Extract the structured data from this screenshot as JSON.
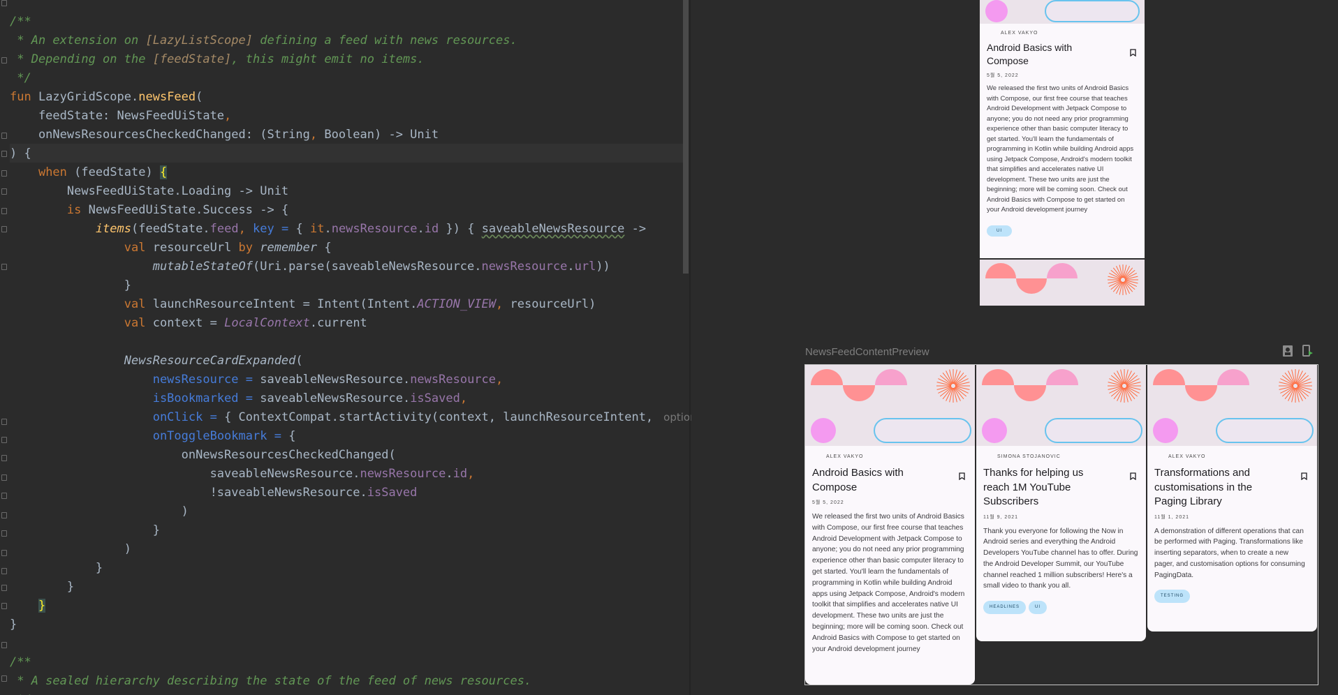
{
  "editor": {
    "lines": [
      {
        "segs": [
          {
            "t": "/**",
            "c": "cm"
          }
        ]
      },
      {
        "segs": [
          {
            "t": " * An extension on ",
            "c": "cm"
          },
          {
            "t": "[LazyListScope]",
            "c": "cmref"
          },
          {
            "t": " defining a feed with news resources.",
            "c": "cm"
          }
        ]
      },
      {
        "segs": [
          {
            "t": " * Depending on the ",
            "c": "cm"
          },
          {
            "t": "[feedState]",
            "c": "cmref"
          },
          {
            "t": ", this might emit no items.",
            "c": "cm"
          }
        ]
      },
      {
        "segs": [
          {
            "t": " */",
            "c": "cm"
          }
        ]
      },
      {
        "segs": [
          {
            "t": "fun ",
            "c": "kw"
          },
          {
            "t": "LazyGridScope.",
            "c": ""
          },
          {
            "t": "newsFeed",
            "c": "fn"
          },
          {
            "t": "(",
            "c": ""
          }
        ]
      },
      {
        "segs": [
          {
            "t": "    feedState: NewsFeedUiState",
            "c": ""
          },
          {
            "t": ",",
            "c": "kw"
          }
        ]
      },
      {
        "segs": [
          {
            "t": "    onNewsResourcesCheckedChanged: (String",
            "c": ""
          },
          {
            "t": ", ",
            "c": "kw"
          },
          {
            "t": "Boolean) -> Unit",
            "c": ""
          }
        ]
      },
      {
        "segs": [
          {
            "t": ") {",
            "c": ""
          }
        ]
      },
      {
        "segs": [
          {
            "t": "    ",
            "c": ""
          },
          {
            "t": "when ",
            "c": "kw"
          },
          {
            "t": "(feedState) ",
            "c": ""
          },
          {
            "t": "{",
            "c": "brace-hl"
          }
        ]
      },
      {
        "segs": [
          {
            "t": "        NewsFeedUiState.Loading -> Unit",
            "c": ""
          }
        ]
      },
      {
        "segs": [
          {
            "t": "        ",
            "c": ""
          },
          {
            "t": "is ",
            "c": "kw"
          },
          {
            "t": "NewsFeedUiState.Success -> {",
            "c": ""
          }
        ]
      },
      {
        "segs": [
          {
            "t": "            ",
            "c": ""
          },
          {
            "t": "items",
            "c": "fn ital"
          },
          {
            "t": "(feedState.",
            "c": ""
          },
          {
            "t": "feed",
            "c": "prop"
          },
          {
            "t": ", ",
            "c": "kw"
          },
          {
            "t": "key ",
            "c": "named"
          },
          {
            "t": "= ",
            "c": "named"
          },
          {
            "t": "{ ",
            "c": ""
          },
          {
            "t": "it",
            "c": "kw"
          },
          {
            "t": ".",
            "c": ""
          },
          {
            "t": "newsResource",
            "c": "prop"
          },
          {
            "t": ".",
            "c": ""
          },
          {
            "t": "id",
            "c": "prop"
          },
          {
            "t": " }) { ",
            "c": ""
          },
          {
            "t": "saveableNewsResource",
            "c": "wavy"
          },
          {
            "t": " ->",
            "c": ""
          }
        ]
      },
      {
        "segs": [
          {
            "t": "                ",
            "c": ""
          },
          {
            "t": "val ",
            "c": "kw"
          },
          {
            "t": "resourceUrl ",
            "c": ""
          },
          {
            "t": "by ",
            "c": "kw"
          },
          {
            "t": "remember",
            "c": "ital"
          },
          {
            "t": " {",
            "c": ""
          }
        ]
      },
      {
        "segs": [
          {
            "t": "                    ",
            "c": ""
          },
          {
            "t": "mutableStateOf",
            "c": "ital"
          },
          {
            "t": "(Uri.parse(saveableNewsResource.",
            "c": ""
          },
          {
            "t": "newsResource",
            "c": "prop"
          },
          {
            "t": ".",
            "c": ""
          },
          {
            "t": "url",
            "c": "prop"
          },
          {
            "t": "))",
            "c": ""
          }
        ]
      },
      {
        "segs": [
          {
            "t": "                }",
            "c": ""
          }
        ]
      },
      {
        "segs": [
          {
            "t": "                ",
            "c": ""
          },
          {
            "t": "val ",
            "c": "kw"
          },
          {
            "t": "launchResourceIntent = Intent(Intent.",
            "c": ""
          },
          {
            "t": "ACTION_VIEW",
            "c": "prop ital"
          },
          {
            "t": ", ",
            "c": "kw"
          },
          {
            "t": "resourceUrl)",
            "c": ""
          }
        ]
      },
      {
        "segs": [
          {
            "t": "                ",
            "c": ""
          },
          {
            "t": "val ",
            "c": "kw"
          },
          {
            "t": "context = ",
            "c": ""
          },
          {
            "t": "LocalContext",
            "c": "prop ital"
          },
          {
            "t": ".current",
            "c": ""
          }
        ]
      },
      {
        "segs": [
          {
            "t": "",
            "c": ""
          }
        ]
      },
      {
        "segs": [
          {
            "t": "                ",
            "c": ""
          },
          {
            "t": "NewsResourceCardExpanded",
            "c": "ital"
          },
          {
            "t": "(",
            "c": ""
          }
        ]
      },
      {
        "segs": [
          {
            "t": "                    ",
            "c": ""
          },
          {
            "t": "newsResource ",
            "c": "named"
          },
          {
            "t": "= ",
            "c": "named"
          },
          {
            "t": "saveableNewsResource.",
            "c": ""
          },
          {
            "t": "newsResource",
            "c": "prop"
          },
          {
            "t": ",",
            "c": "kw"
          }
        ]
      },
      {
        "segs": [
          {
            "t": "                    ",
            "c": ""
          },
          {
            "t": "isBookmarked ",
            "c": "named"
          },
          {
            "t": "= ",
            "c": "named"
          },
          {
            "t": "saveableNewsResource.",
            "c": ""
          },
          {
            "t": "isSaved",
            "c": "prop"
          },
          {
            "t": ",",
            "c": "kw"
          }
        ]
      },
      {
        "segs": [
          {
            "t": "                    ",
            "c": ""
          },
          {
            "t": "onClick ",
            "c": "named"
          },
          {
            "t": "= ",
            "c": "named"
          },
          {
            "t": "{ ContextCompat.startActivity(context, launchResourceIntent, ",
            "c": ""
          },
          {
            "t": " options:",
            "c": "ihint"
          }
        ]
      },
      {
        "segs": [
          {
            "t": "                    ",
            "c": ""
          },
          {
            "t": "onToggleBookmark ",
            "c": "named"
          },
          {
            "t": "= ",
            "c": "named"
          },
          {
            "t": "{",
            "c": ""
          }
        ]
      },
      {
        "segs": [
          {
            "t": "                        onNewsResourcesCheckedChanged(",
            "c": ""
          }
        ]
      },
      {
        "segs": [
          {
            "t": "                            saveableNewsResource.",
            "c": ""
          },
          {
            "t": "newsResource",
            "c": "prop"
          },
          {
            "t": ".",
            "c": ""
          },
          {
            "t": "id",
            "c": "prop"
          },
          {
            "t": ",",
            "c": "kw"
          }
        ]
      },
      {
        "segs": [
          {
            "t": "                            !saveableNewsResource.",
            "c": ""
          },
          {
            "t": "isSaved",
            "c": "prop"
          }
        ]
      },
      {
        "segs": [
          {
            "t": "                        )",
            "c": ""
          }
        ]
      },
      {
        "segs": [
          {
            "t": "                    }",
            "c": ""
          }
        ]
      },
      {
        "segs": [
          {
            "t": "                )",
            "c": ""
          }
        ]
      },
      {
        "segs": [
          {
            "t": "            }",
            "c": ""
          }
        ]
      },
      {
        "segs": [
          {
            "t": "        }",
            "c": ""
          }
        ]
      },
      {
        "segs": [
          {
            "t": "    ",
            "c": ""
          },
          {
            "t": "}",
            "c": "brace-hl"
          }
        ]
      },
      {
        "segs": [
          {
            "t": "}",
            "c": ""
          }
        ]
      },
      {
        "segs": [
          {
            "t": "",
            "c": ""
          }
        ]
      },
      {
        "segs": [
          {
            "t": "/**",
            "c": "cm"
          }
        ]
      },
      {
        "segs": [
          {
            "t": " * A sealed hierarchy describing the state of the feed of news resources.",
            "c": "cm"
          }
        ]
      },
      {
        "segs": [
          {
            "t": " */",
            "c": "cm"
          }
        ]
      }
    ]
  },
  "preview": {
    "label": "NewsFeedContentPreview",
    "top_card": {
      "author": "ALEX VAKYO",
      "title": "Android Basics with Compose",
      "date": "5월 5, 2022",
      "body": "We released the first two units of Android Basics with Compose, our first free course that teaches Android Development with Jetpack Compose to anyone; you do not need any prior programming experience other than basic computer literacy to get started. You'll learn the fundamentals of programming in Kotlin while building Android apps using Jetpack Compose, Android's modern toolkit that simplifies and accelerates native UI development. These two units are just the beginning; more will be coming soon. Check out Android Basics with Compose to get started on your Android development journey",
      "chips": [
        "UI"
      ]
    },
    "cards": [
      {
        "author": "ALEX VAKYO",
        "title": "Android Basics with Compose",
        "date": "5월 5, 2022",
        "body": "We released the first two units of Android Basics with Compose, our first free course that teaches Android Development with Jetpack Compose to anyone; you do not need any prior programming experience other than basic computer literacy to get started. You'll learn the fundamentals of programming in Kotlin while building Android apps using Jetpack Compose, Android's modern toolkit that simplifies and accelerates native UI development. These two units are just the beginning; more will be coming soon. Check out Android Basics with Compose to get started on your Android development journey",
        "chips": []
      },
      {
        "author": "SIMONA STOJANOVIC",
        "title": "Thanks for helping us reach 1M YouTube Subscribers",
        "date": "11월 9, 2021",
        "body": "Thank you everyone for following the Now in Android series and everything the Android Developers YouTube channel has to offer. During the Android Developer Summit, our YouTube channel reached 1 million subscribers! Here's a small video to thank you all.",
        "chips": [
          "HEADLINES",
          "UI"
        ]
      },
      {
        "author": "ALEX VAKYO",
        "title": "Transformations and customisations in the Paging Library",
        "date": "11월 1, 2021",
        "body": "A demonstration of different operations that can be performed with Paging. Transformations like inserting separators, when to create a new pager, and customisation options for consuming PagingData.",
        "chips": [
          "TESTING"
        ]
      }
    ],
    "colors": {
      "header_bg": "#ebe3ea",
      "semicircle": "#ff9193",
      "avatar": "#f49af0",
      "chip_bg": "#bde3fa",
      "follow_border": "#68c3ee"
    }
  }
}
